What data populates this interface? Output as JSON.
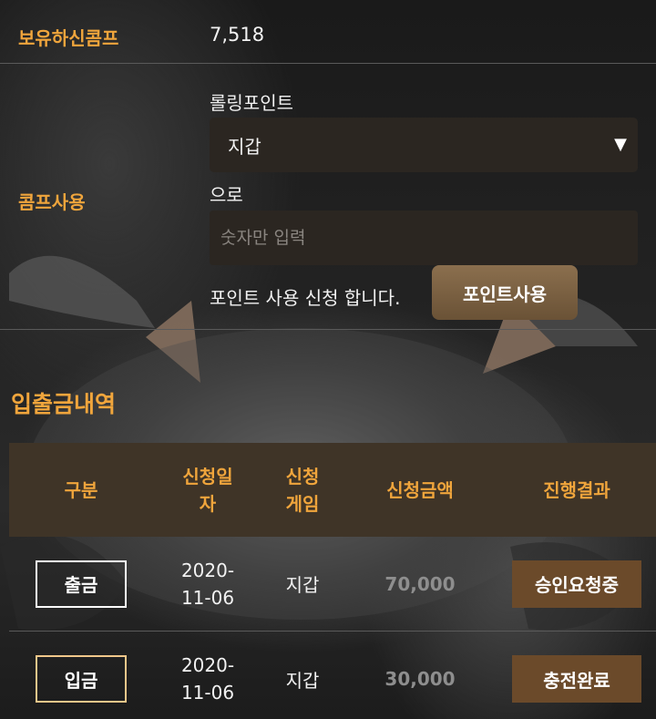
{
  "comp": {
    "label": "보유하신콤프",
    "value": "7,518"
  },
  "comp_use": {
    "label": "콤프사용",
    "rolling_label": "롤링포인트",
    "select_value": "지갑",
    "select_arrow": "▼",
    "to_label": "으로",
    "input_placeholder": "숫자만 입력",
    "input_value": "",
    "apply_text": "포인트 사용 신청 합니다.",
    "button_label": "포인트사용"
  },
  "history": {
    "title": "입출금내역",
    "columns": [
      "구분",
      "신청일\n자",
      "신청\n게임",
      "신청금액",
      "진행결과"
    ],
    "rows": [
      {
        "type": "출금",
        "date": "2020-\n11-06",
        "game": "지갑",
        "amount": "70,000",
        "status": "승인요청중"
      },
      {
        "type": "입금",
        "date": "2020-\n11-06",
        "game": "지갑",
        "amount": "30,000",
        "status": "충전완료"
      }
    ]
  }
}
